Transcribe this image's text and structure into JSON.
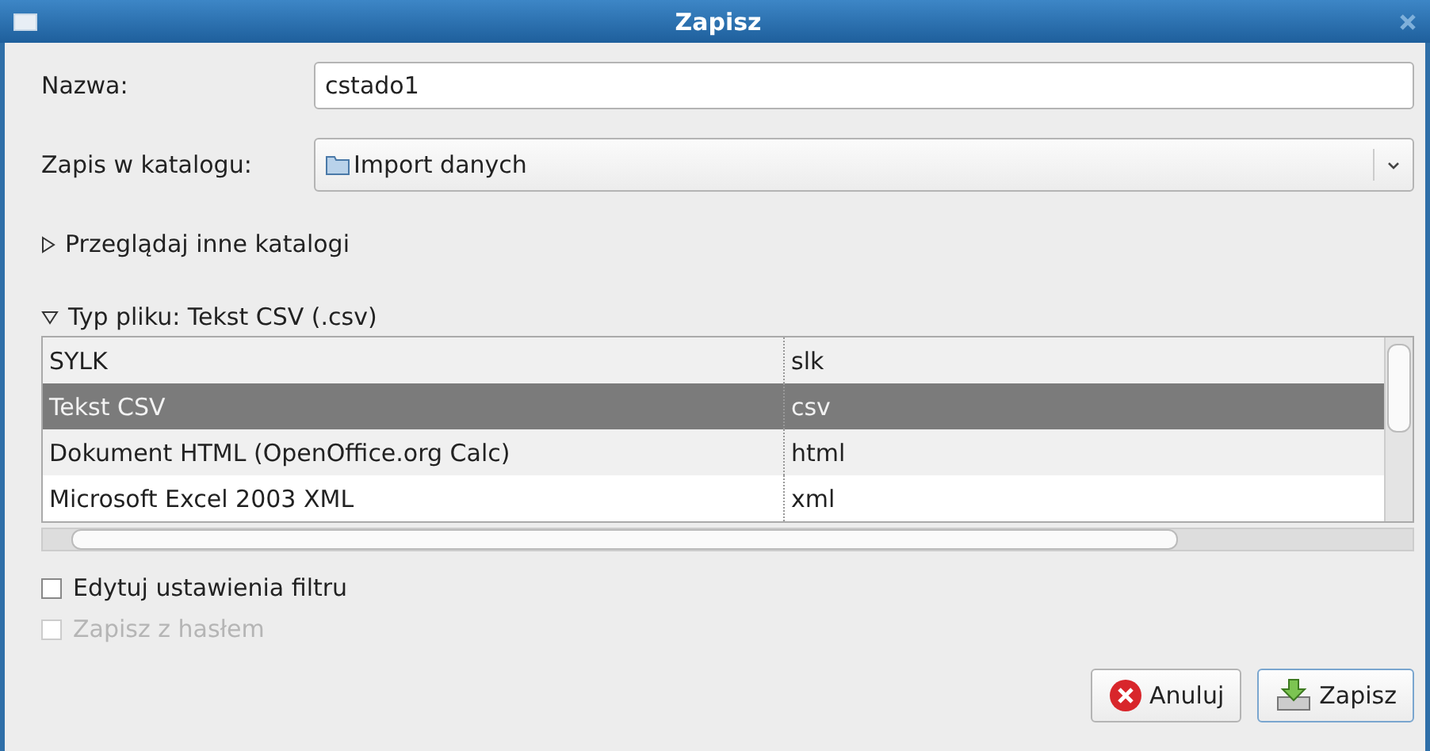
{
  "window": {
    "title": "Zapisz"
  },
  "name_field": {
    "label": "Nazwa:",
    "value": "cstado1"
  },
  "folder_field": {
    "label": "Zapis w katalogu:",
    "value": "Import danych"
  },
  "browse": {
    "label": "Przeglądaj inne katalogi",
    "expanded": false
  },
  "file_type": {
    "label": "Typ pliku: Tekst CSV (.csv)",
    "expanded": true
  },
  "table": {
    "rows": [
      {
        "name": "SYLK",
        "ext": "slk",
        "selected": false
      },
      {
        "name": "Tekst CSV",
        "ext": "csv",
        "selected": true
      },
      {
        "name": "Dokument HTML (OpenOffice.org Calc)",
        "ext": "html",
        "selected": false
      },
      {
        "name": "Microsoft Excel 2003 XML",
        "ext": "xml",
        "selected": false
      }
    ]
  },
  "options": [
    {
      "label": "Edytuj ustawienia filtru",
      "checked": false,
      "disabled": false
    },
    {
      "label": "Zapisz z hasłem",
      "checked": false,
      "disabled": true
    }
  ],
  "buttons": [
    {
      "kind": "cancel",
      "label": "Anuluj"
    },
    {
      "kind": "save",
      "label": "Zapisz"
    }
  ]
}
